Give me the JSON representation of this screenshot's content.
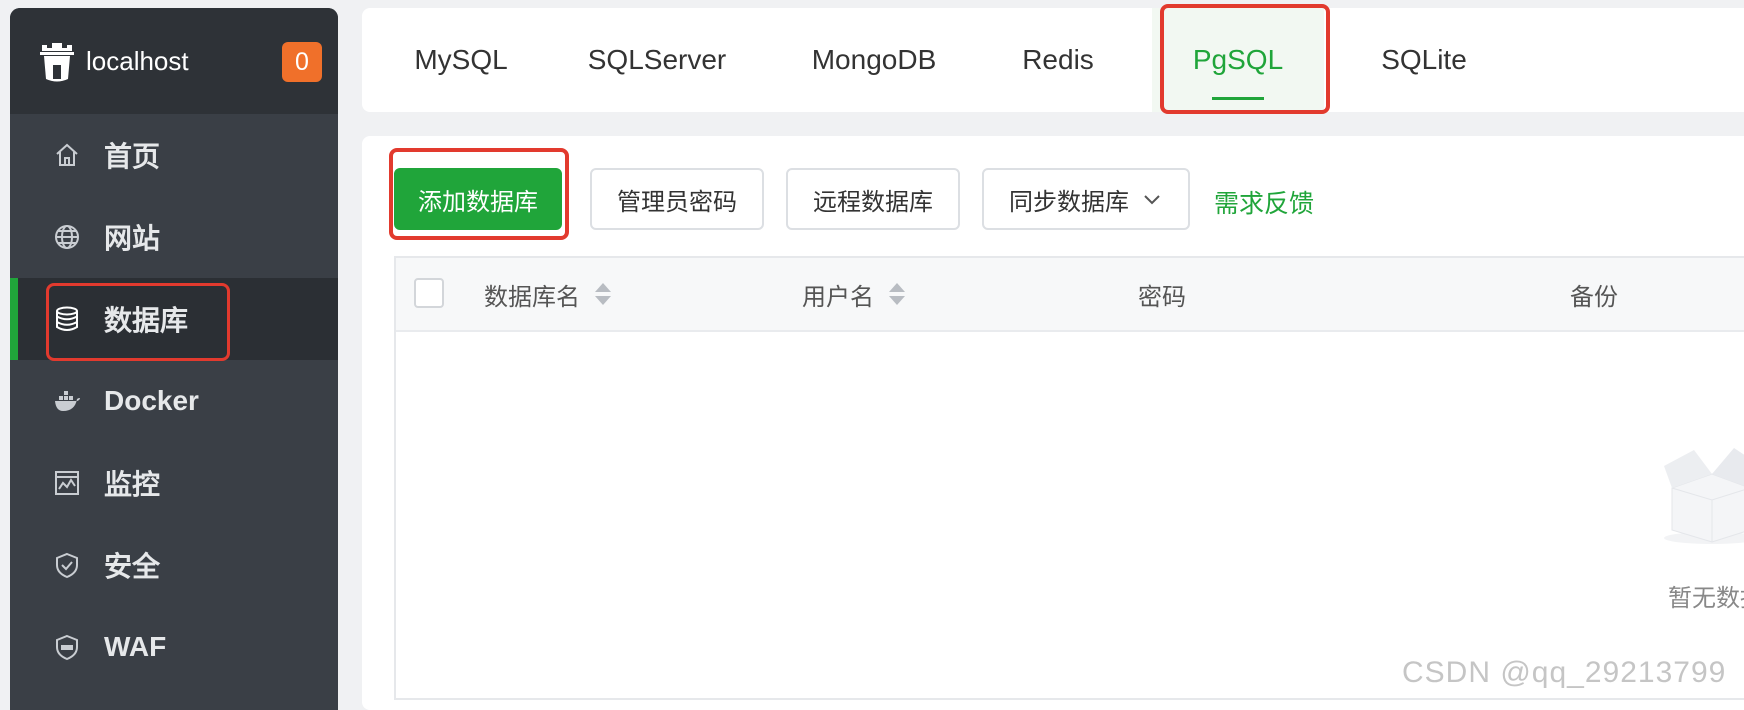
{
  "sidebar": {
    "brand": "localhost",
    "badge": "0",
    "items": [
      {
        "label": "首页",
        "icon": "home-icon"
      },
      {
        "label": "网站",
        "icon": "globe-icon"
      },
      {
        "label": "数据库",
        "icon": "database-icon",
        "active": true
      },
      {
        "label": "Docker",
        "icon": "docker-icon"
      },
      {
        "label": "监控",
        "icon": "monitor-icon"
      },
      {
        "label": "安全",
        "icon": "shield-icon"
      },
      {
        "label": "WAF",
        "icon": "waf-shield-icon"
      }
    ]
  },
  "tabs": [
    {
      "label": "MySQL"
    },
    {
      "label": "SQLServer"
    },
    {
      "label": "MongoDB"
    },
    {
      "label": "Redis"
    },
    {
      "label": "PgSQL",
      "active": true
    },
    {
      "label": "SQLite"
    }
  ],
  "toolbar": {
    "add_db": "添加数据库",
    "admin_pwd": "管理员密码",
    "remote_db": "远程数据库",
    "sync_db": "同步数据库",
    "feedback": "需求反馈"
  },
  "table": {
    "columns": [
      "数据库名",
      "用户名",
      "密码",
      "备份"
    ],
    "empty_text": "暂无数据"
  },
  "watermark": "CSDN @qq_29213799",
  "colors": {
    "accent": "#20a53a",
    "sidebar_bg": "#3a3f46",
    "badge": "#f0702a",
    "highlight": "#e23a2e"
  }
}
